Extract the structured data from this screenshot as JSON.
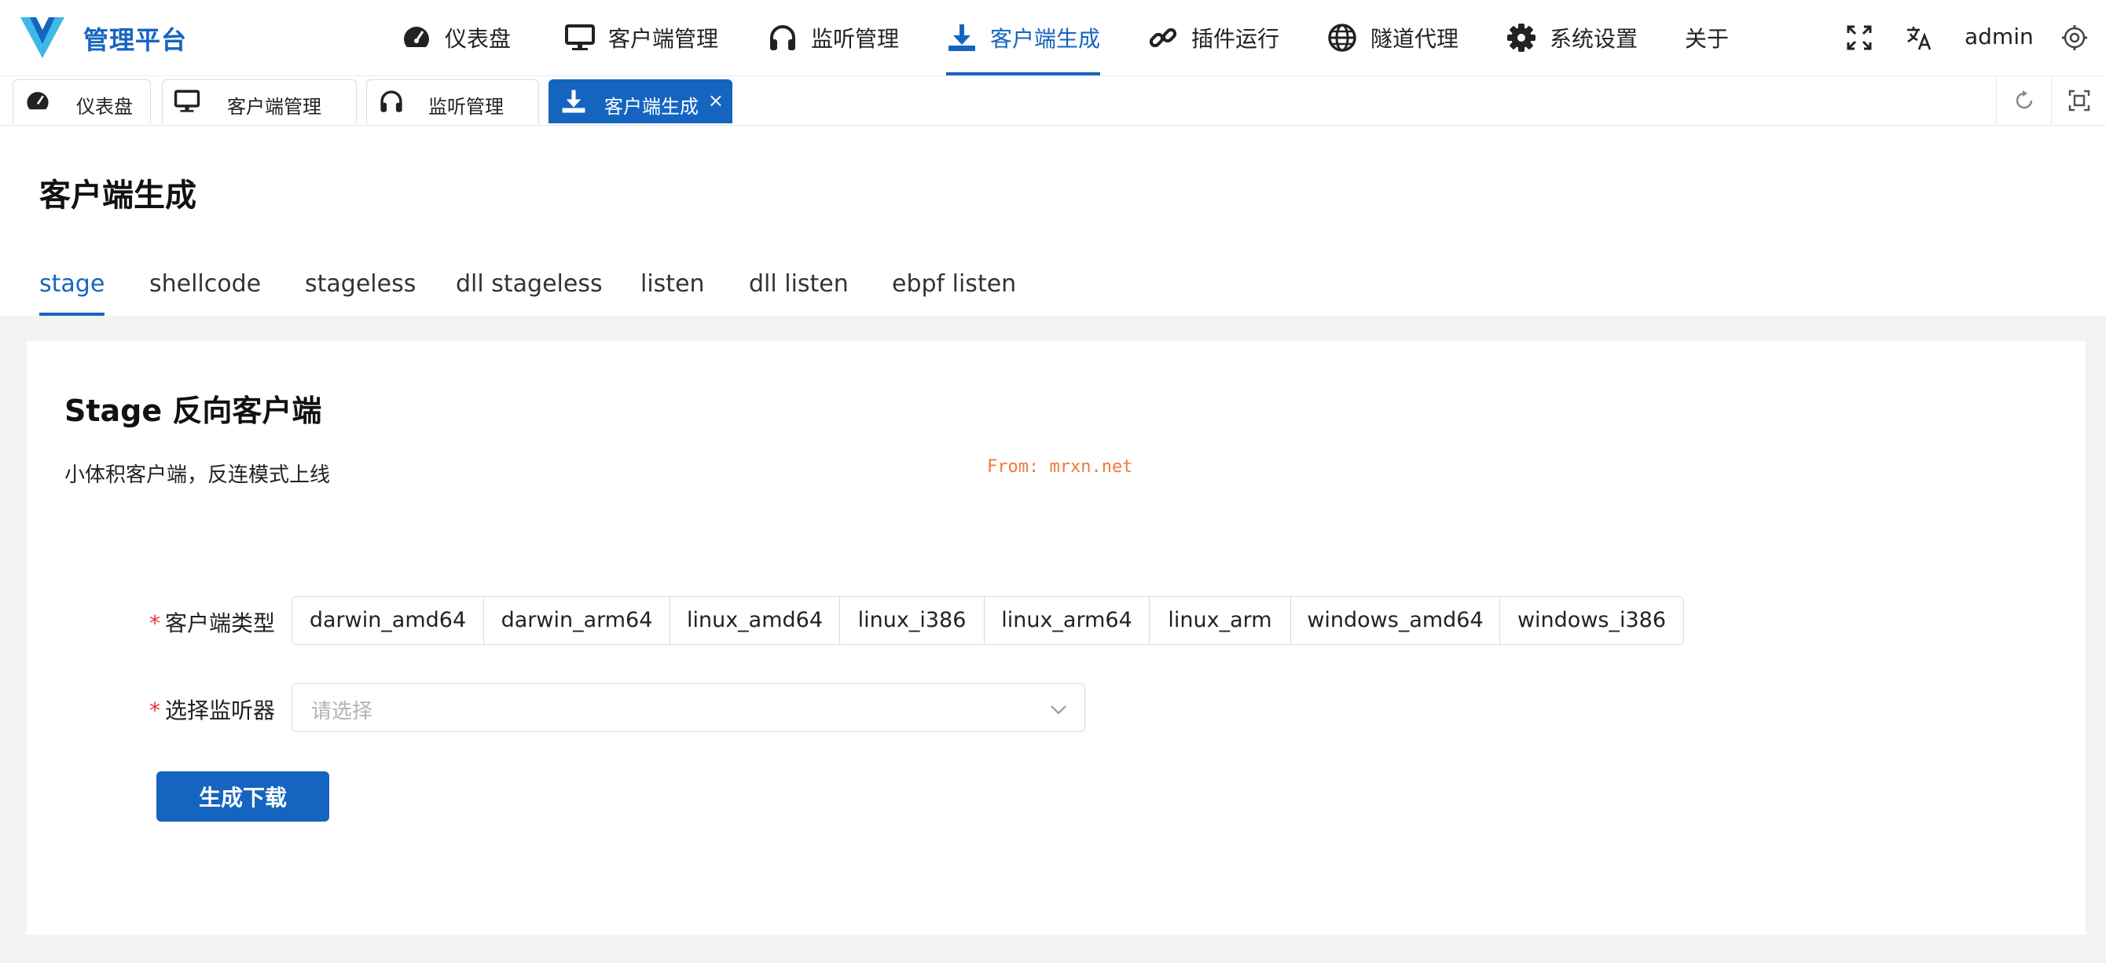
{
  "header": {
    "brand": "管理平台",
    "nav": [
      {
        "label": "仪表盘",
        "icon": "dashboard-icon"
      },
      {
        "label": "客户端管理",
        "icon": "monitor-icon"
      },
      {
        "label": "监听管理",
        "icon": "headphones-icon"
      },
      {
        "label": "客户端生成",
        "icon": "download-icon",
        "active": true
      },
      {
        "label": "插件运行",
        "icon": "plugin-link-icon"
      },
      {
        "label": "隧道代理",
        "icon": "globe-icon"
      },
      {
        "label": "系统设置",
        "icon": "gear-icon"
      },
      {
        "label": "关于"
      }
    ],
    "user": "admin",
    "accent_color": "#1565c0"
  },
  "page_tabs": [
    {
      "label": "仪表盘",
      "icon": "dashboard-icon"
    },
    {
      "label": "客户端管理",
      "icon": "monitor-icon"
    },
    {
      "label": "监听管理",
      "icon": "headphones-icon"
    },
    {
      "label": "客户端生成",
      "icon": "download-icon",
      "active": true,
      "close": "×"
    }
  ],
  "page": {
    "title": "客户端生成",
    "subtabs": [
      "stage",
      "shellcode",
      "stageless",
      "dll stageless",
      "listen",
      "dll listen",
      "ebpf listen"
    ],
    "active_subtab": "stage"
  },
  "card": {
    "title": "Stage 反向客户端",
    "description": "小体积客户端，反连模式上线",
    "watermark": "From: mrxn.net"
  },
  "form": {
    "client_type_label": "客户端类型",
    "client_types": [
      "darwin_amd64",
      "darwin_arm64",
      "linux_amd64",
      "linux_i386",
      "linux_arm64",
      "linux_arm",
      "windows_amd64",
      "windows_i386"
    ],
    "listener_label": "选择监听器",
    "listener_placeholder": "请选择",
    "required_mark": "*",
    "submit_label": "生成下载"
  }
}
